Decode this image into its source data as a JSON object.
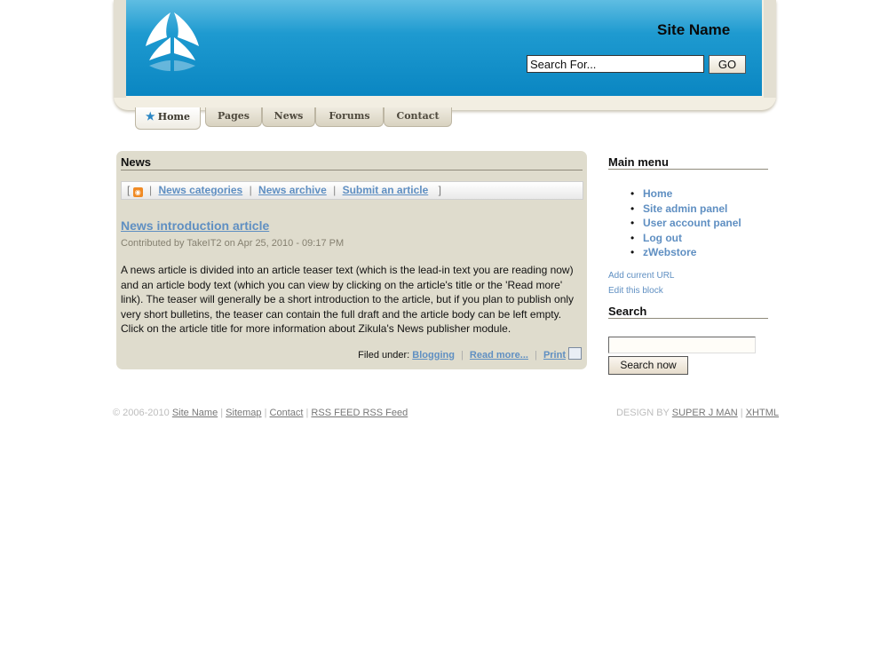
{
  "header": {
    "site_name": "Site Name",
    "search_placeholder": "Search For...",
    "go_label": "GO",
    "logo_icon": "bird-wings-logo-icon",
    "banner_color": "#0a86c2"
  },
  "tabs": [
    {
      "label": "Home",
      "active": true,
      "icon": "star-icon"
    },
    {
      "label": "Pages",
      "active": false
    },
    {
      "label": "News",
      "active": false
    },
    {
      "label": "Forums",
      "active": false
    },
    {
      "label": "Contact",
      "active": false
    }
  ],
  "main": {
    "heading": "News",
    "subnav": {
      "open": "[",
      "rss_icon": "rss-icon",
      "links": [
        "News categories",
        "News archive",
        "Submit an article"
      ],
      "close": "]"
    },
    "article": {
      "title": "News introduction article",
      "meta": "Contributed by TakeIT2 on Apr 25, 2010 - 09:17 PM",
      "body": "A news article is divided into an article teaser text (which is the lead-in text you are reading now) and an article body text (which you can view by clicking on the article's title or the 'Read more' link). The teaser will generally be a short introduction to the article, but if you plan to publish only very short bulletins, the teaser can contain the full draft and the article body can be left empty. Click on the article title for more information about Zikula's News publisher module.",
      "filed_label": "Filed under:",
      "category_link": "Blogging",
      "read_more": "Read more...",
      "print_label": "Print",
      "print_icon": "printer-icon"
    }
  },
  "sidebar": {
    "menu_heading": "Main menu",
    "menu_items": [
      "Home",
      "Site admin panel",
      "User account panel",
      "Log out",
      "zWebstore"
    ],
    "add_url": "Add current URL",
    "edit_block": "Edit this block",
    "search_heading": "Search",
    "search_button": "Search now"
  },
  "footer": {
    "copyright": "© 2006-2010",
    "left_links": [
      "Site Name",
      "Sitemap",
      "Contact",
      "RSS FEED RSS Feed"
    ],
    "design_by": "DESIGN BY",
    "right_links": [
      "SUPER J MAN",
      "XHTML"
    ]
  },
  "colors": {
    "link": "#5f8fc2",
    "content_bg": "#dfdccd"
  }
}
